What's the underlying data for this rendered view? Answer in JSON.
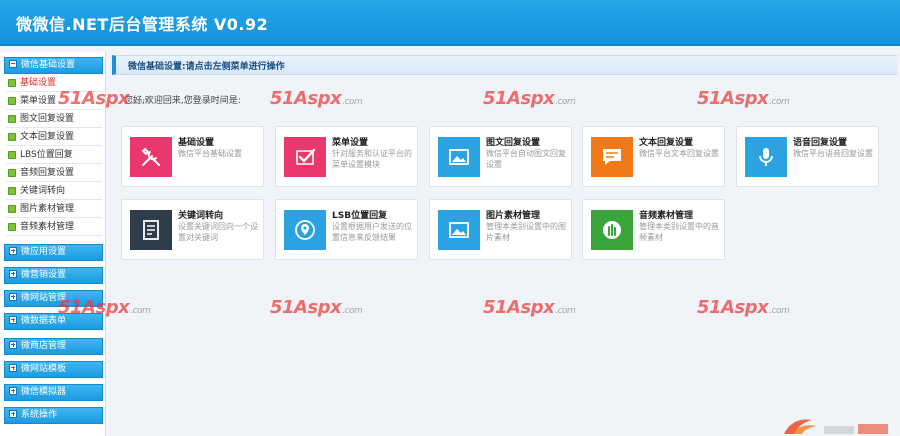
{
  "app": {
    "title": "微微信.NET后台管理系统 V0.92"
  },
  "sidebar": {
    "groups": [
      {
        "label": "微信基础设置"
      },
      {
        "label": "微应用设置"
      },
      {
        "label": "微营销设置"
      },
      {
        "label": "微网站管理"
      },
      {
        "label": "微数据表单"
      },
      {
        "label": "微商店管理"
      },
      {
        "label": "微网站模板"
      },
      {
        "label": "微信模拟器"
      },
      {
        "label": "系统操作"
      }
    ],
    "items": [
      {
        "label": "基础设置"
      },
      {
        "label": "菜单设置"
      },
      {
        "label": "图文回复设置"
      },
      {
        "label": "文本回复设置"
      },
      {
        "label": "LBS位置回复"
      },
      {
        "label": "音频回复设置"
      },
      {
        "label": "关键词转向"
      },
      {
        "label": "图片素材管理"
      },
      {
        "label": "音频素材管理"
      }
    ]
  },
  "main": {
    "breadcrumb": "微信基础设置:请点击左侧菜单进行操作",
    "welcome": "您好,欢迎回来,您登录时间是:",
    "cards": [
      {
        "title": "基础设置",
        "desc": "微信平台基础设置",
        "color": "#e8386d",
        "icon": "tools-icon"
      },
      {
        "title": "菜单设置",
        "desc": "针对服务和认证平台的菜单设置模块",
        "color": "#e8386d",
        "icon": "check-icon"
      },
      {
        "title": "图文回复设置",
        "desc": "微信平台自动图文回复设置",
        "color": "#2aa3e0",
        "icon": "image-icon"
      },
      {
        "title": "文本回复设置",
        "desc": "微信平台文本回复设置",
        "color": "#f07a1a",
        "icon": "message-icon"
      },
      {
        "title": "语音回复设置",
        "desc": "微信平台语音回复设置",
        "color": "#2aa3e0",
        "icon": "microphone-icon"
      },
      {
        "title": "关键词转向",
        "desc": "设置关键词回向一个设置对关键词",
        "color": "#2f3c4a",
        "icon": "document-icon"
      },
      {
        "title": "LSB位置回复",
        "desc": "设置根据用户发送的位置信息来反馈结果",
        "color": "#2aa3e0",
        "icon": "location-icon"
      },
      {
        "title": "图片素材管理",
        "desc": "管理本类别设置中的图片素材",
        "color": "#2aa3e0",
        "icon": "image-icon"
      },
      {
        "title": "音频素材管理",
        "desc": "管理本类别设置中的音频素材",
        "color": "#3aa53a",
        "icon": "audio-icon"
      }
    ]
  },
  "watermark": {
    "brand": "51Aspx",
    "suffix": ".com"
  }
}
